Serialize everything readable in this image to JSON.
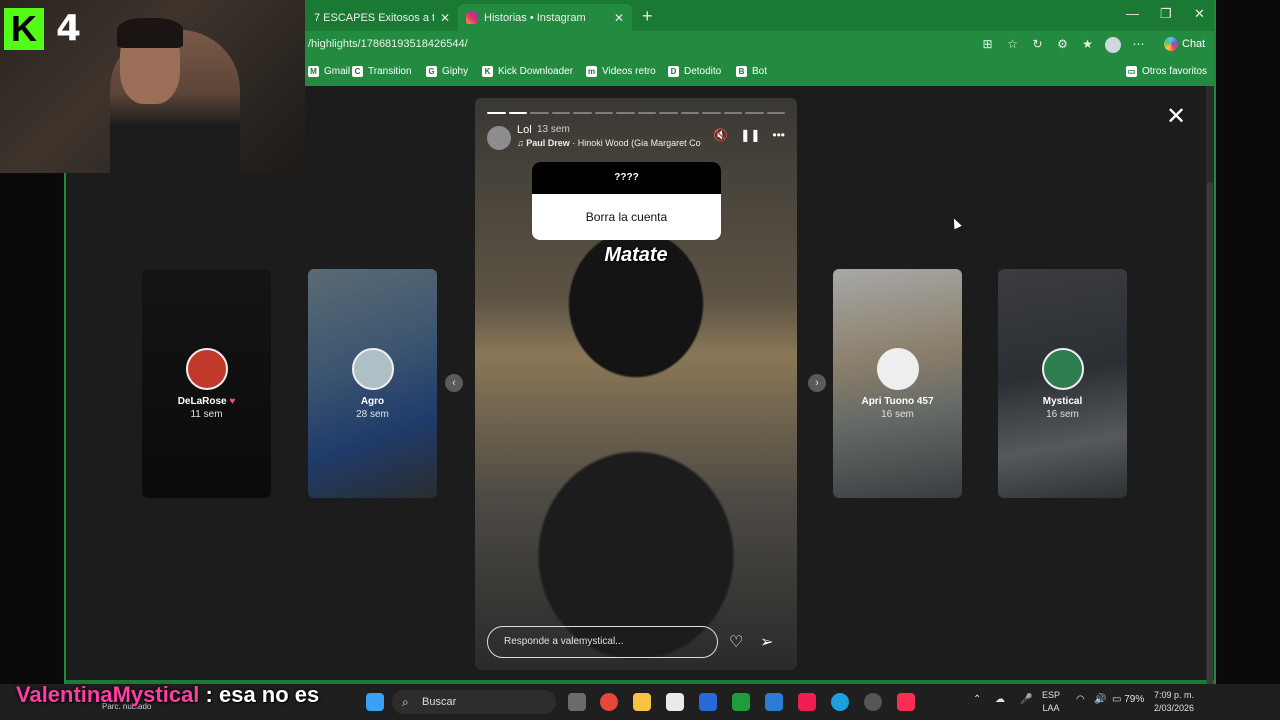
{
  "browser": {
    "tabs": [
      {
        "title": "7 ESCAPES Exitosos a toda Velo"
      },
      {
        "title": "Historias • Instagram"
      }
    ],
    "url": "/highlights/17868193518426544/",
    "chat_label": "Chat",
    "bookmarks": [
      "Gmail",
      "Transition",
      "Giphy",
      "Kick Downloader",
      "Videos retro",
      "Detodito",
      "Bot"
    ],
    "other_favorites": "Otros favoritos"
  },
  "webcam": {
    "kick_letter": "K",
    "count": "4"
  },
  "stories": {
    "side": [
      {
        "name": "DeLaRose",
        "time": "11 sem",
        "avatar_color": "#c0392b"
      },
      {
        "name": "Agro",
        "time": "28 sem",
        "avatar_color": "#b0bec5"
      },
      {
        "name": "Apri Tuono 457",
        "time": "16 sem",
        "avatar_color": "#eeeeee"
      },
      {
        "name": "Mystical",
        "time": "16 sem",
        "avatar_color": "#2e7d4f"
      }
    ],
    "heart": "♥",
    "main": {
      "user": "Lol",
      "time": "13 sem",
      "music_artist": "Paul Drew",
      "music_track": " · Hinoki Wood (Gia Margaret Co",
      "question": "????",
      "answer": "Borra la cuenta",
      "overlay": "Matate",
      "reply_placeholder": "Responde a valemystical...",
      "segments_total": 14,
      "segments_done": 2
    }
  },
  "taskbar": {
    "search": "Buscar",
    "weather": "Parc. nublado",
    "lang1": "ESP",
    "lang2": "LAA",
    "battery": "79%",
    "time": "7:09 p. m.",
    "date": "2/03/2026"
  },
  "chat": {
    "user": "ValentinaMystical",
    "message": " : esa no es"
  },
  "colors": {
    "browser_green": "#1b7a35",
    "kick_green": "#53fc18",
    "chat_user": "#ff3ea5"
  }
}
